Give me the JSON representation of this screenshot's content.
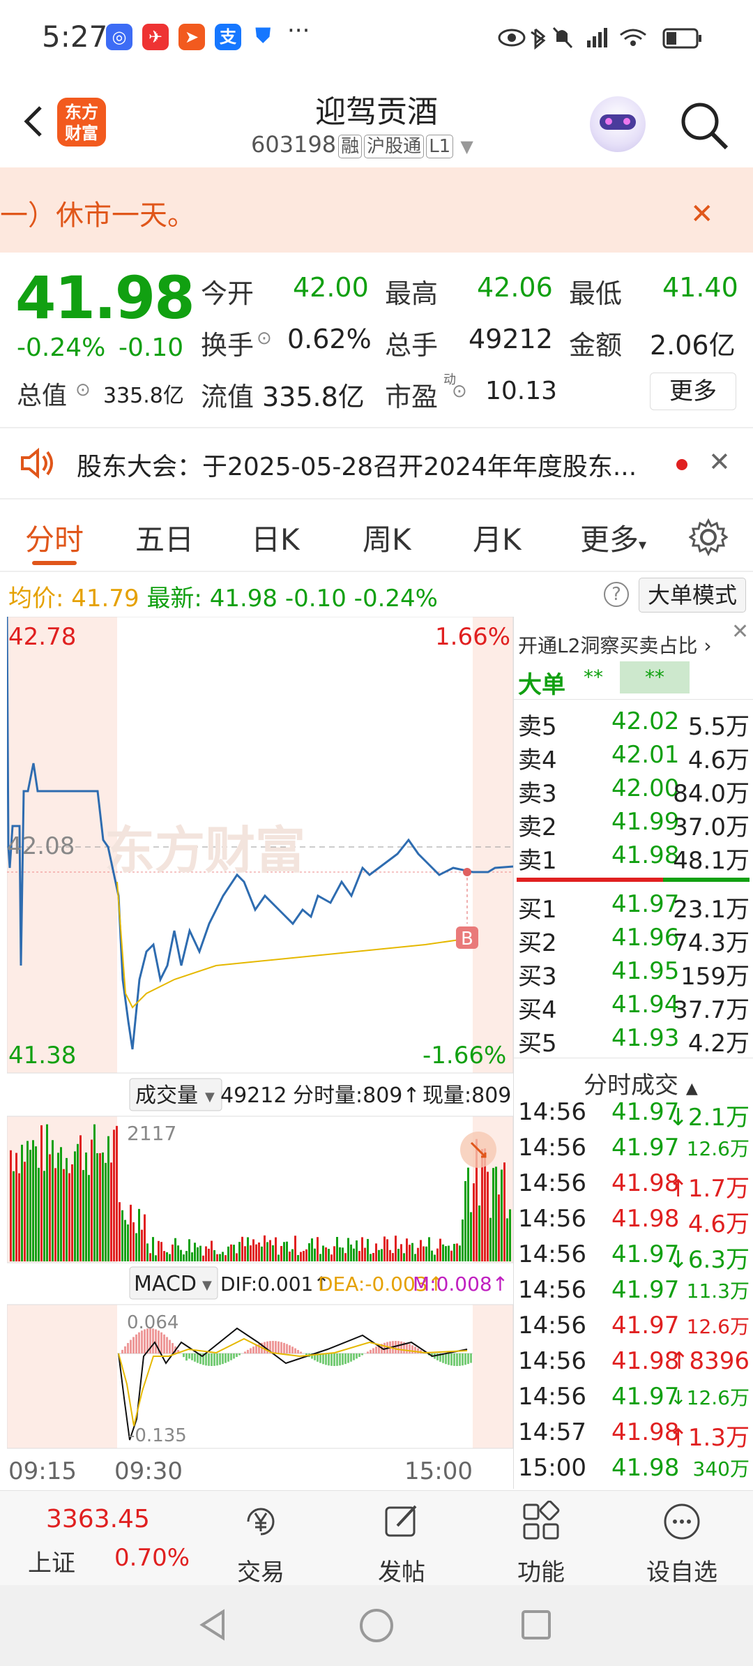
{
  "status_bar": {
    "time": "5:27",
    "more": "···"
  },
  "header": {
    "title": "迎驾贡酒",
    "code": "603198",
    "tag_margin": "融",
    "tag_connect": "沪股通",
    "tag_level": "L1",
    "logo_line1": "东方",
    "logo_line2": "财富"
  },
  "banner": {
    "text": "一）休市一天。"
  },
  "quote": {
    "price": "41.98",
    "change_pct": "-0.24%",
    "change": "-0.10",
    "open_label": "今开",
    "open": "42.00",
    "high_label": "最高",
    "high": "42.06",
    "low_label": "最低",
    "low": "41.40",
    "turnover_label": "换手",
    "turnover": "0.62%",
    "volume_label": "总手",
    "volume": "49212",
    "amount_label": "金额",
    "amount": "2.06亿",
    "mktcap_label": "总值",
    "mktcap": "335.8亿",
    "float_label": "流值",
    "float": "335.8亿",
    "pe_label": "市盈",
    "pe_sup": "动",
    "pe": "10.13",
    "more": "更多"
  },
  "notice": {
    "text": "股东大会：于2025-05-28召开2024年年度股东..."
  },
  "tabs": [
    "分时",
    "五日",
    "日K",
    "周K",
    "月K",
    "更多"
  ],
  "price_line": {
    "avg_label": "均价:",
    "avg": "41.79",
    "latest_label": "最新:",
    "latest": "41.98",
    "chg": "-0.10",
    "pct": "-0.24%",
    "help": "?",
    "big_mode": "大单模式"
  },
  "chart": {
    "top_price": "42.78",
    "top_pct": "1.66%",
    "bottom_price": "41.38",
    "bottom_pct": "-1.66%",
    "ref_price": "42.08",
    "watermark": "东方财富",
    "marker": "B",
    "vol_label": "成交量",
    "vol_total": "49212",
    "vol_min": "分时量:809↑",
    "vol_now": "现量:809",
    "vol_max": "2117",
    "macd_label": "MACD",
    "dif": "DIF:0.001↑",
    "dea": "DEA:-0.003↑",
    "m": "M:0.008↑",
    "macd_top": "0.064",
    "macd_bottom": "-0.135",
    "time_start": "09:15",
    "time_open": "09:30",
    "time_end": "15:00"
  },
  "chart_data": {
    "type": "line",
    "ylim": [
      41.38,
      42.78
    ],
    "ref": 42.08,
    "series": [
      {
        "values": [
          42.78,
          42.3,
          41.5,
          42.15,
          42.2,
          42.15,
          42.1,
          42.1,
          42.08,
          41.6,
          41.42,
          41.55,
          41.7,
          41.75,
          41.78,
          41.88,
          41.92,
          41.85,
          41.88,
          41.87,
          41.9,
          41.95,
          41.97,
          42.0,
          42.02,
          41.99,
          41.98,
          41.98
        ]
      },
      {
        "values": [
          41.6,
          41.64,
          41.66,
          41.68,
          41.69,
          41.7,
          41.71,
          41.72,
          41.73,
          41.74,
          41.75,
          41.76,
          41.77,
          41.78,
          41.79
        ]
      }
    ]
  },
  "right_panel": {
    "l2_text": "开通L2洞察买卖占比",
    "big_label": "大单",
    "stars1": "**",
    "stars2": "**",
    "asks": [
      {
        "name": "卖5",
        "price": "42.02",
        "vol": "5.5万"
      },
      {
        "name": "卖4",
        "price": "42.01",
        "vol": "4.6万"
      },
      {
        "name": "卖3",
        "price": "42.00",
        "vol": "84.0万"
      },
      {
        "name": "卖2",
        "price": "41.99",
        "vol": "37.0万"
      },
      {
        "name": "卖1",
        "price": "41.98",
        "vol": "48.1万"
      }
    ],
    "bids": [
      {
        "name": "买1",
        "price": "41.97",
        "vol": "23.1万"
      },
      {
        "name": "买2",
        "price": "41.96",
        "vol": "74.3万"
      },
      {
        "name": "买3",
        "price": "41.95",
        "vol": "159万"
      },
      {
        "name": "买4",
        "price": "41.94",
        "vol": "37.7万"
      },
      {
        "name": "买5",
        "price": "41.93",
        "vol": "4.2万"
      }
    ],
    "trades_title": "分时成交",
    "trades": [
      {
        "time": "14:56",
        "price": "41.97",
        "vol": "↓2.1万",
        "color": "#11a011",
        "small": false
      },
      {
        "time": "14:56",
        "price": "41.97",
        "vol": "12.6万",
        "color": "#11a011",
        "small": true
      },
      {
        "time": "14:56",
        "price": "41.98",
        "vol": "↑1.7万",
        "color": "#e02020",
        "small": false
      },
      {
        "time": "14:56",
        "price": "41.98",
        "vol": "4.6万",
        "color": "#e02020",
        "small": false
      },
      {
        "time": "14:56",
        "price": "41.97",
        "vol": "↓6.3万",
        "color": "#11a011",
        "small": false
      },
      {
        "time": "14:56",
        "price": "41.97",
        "vol": "11.3万",
        "color": "#11a011",
        "small": true
      },
      {
        "time": "14:56",
        "price": "41.97",
        "vol": "12.6万",
        "color": "#e02020",
        "small": true
      },
      {
        "time": "14:56",
        "price": "41.98",
        "vol": "↑8396",
        "color": "#e02020",
        "small": false
      },
      {
        "time": "14:56",
        "price": "41.97",
        "vol": "↓12.6万",
        "color": "#11a011",
        "small": true
      },
      {
        "time": "14:57",
        "price": "41.98",
        "vol": "↑1.3万",
        "color": "#e02020",
        "small": false
      },
      {
        "time": "15:00",
        "price": "41.98",
        "vol": "340万",
        "color": "#11a011",
        "small": true
      }
    ]
  },
  "bottom_nav": {
    "index_value": "3363.45",
    "index_name": "上证",
    "index_pct": "0.70%",
    "items": [
      "交易",
      "发帖",
      "功能",
      "设自选"
    ]
  },
  "colors": {
    "up": "#e02020",
    "down": "#11a011",
    "accent": "#e0561a"
  }
}
